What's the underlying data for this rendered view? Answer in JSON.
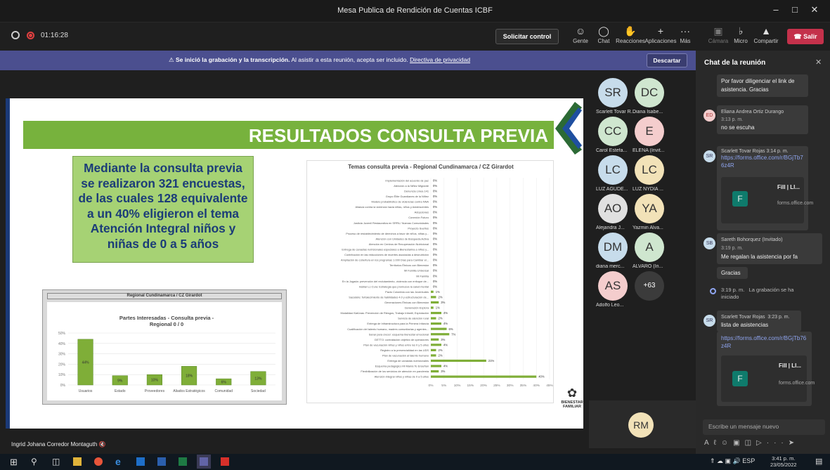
{
  "window": {
    "title": "Mesa Publica de Rendición de Cuentas ICBF"
  },
  "toolbar": {
    "timer": "01:16:28",
    "request_control": "Solicitar control",
    "buttons": [
      "Gente",
      "Chat",
      "Reacciones",
      "Aplicaciones",
      "Más",
      "Cámara",
      "Micro",
      "Compartir"
    ],
    "leave": "Salir"
  },
  "banner": {
    "bold": "Se inició la grabación y la transcripción.",
    "text": "Al asistir a esta reunión, acepta ser incluido.",
    "link": "Directiva de privacidad",
    "dismiss": "Descartar"
  },
  "slide": {
    "title": "RESULTADOS CONSULTA PREVIA",
    "summary": "Mediante la consulta previa se realizaron 321 encuestas, de las cuales 128 equivalente a un 40% eligieron el tema Atención Integral niños y niñas de 0 a 5 años",
    "logo": "BIENESTAR FAMILIAR"
  },
  "chart_data": [
    {
      "type": "bar",
      "title": "Regional Cundinamarca / CZ Girardot",
      "subtitle": "Partes Interesadas - Consulta previa - Regional 0 / 0",
      "categories": [
        "Usuarios",
        "Estado",
        "Proveedores",
        "Aliados Estratégicos",
        "Comunidad",
        "Sociedad"
      ],
      "values": [
        44,
        9,
        10,
        18,
        6,
        13
      ],
      "ylim": [
        0,
        50
      ],
      "yticks": [
        "0%",
        "10%",
        "20%",
        "30%",
        "40%",
        "50%"
      ],
      "color": "#7fae38"
    },
    {
      "type": "bar",
      "orientation": "horizontal",
      "title": "Temas consulta previa - Regional Cundinamarca / CZ Girardot",
      "categories": [
        "Implementación del acuerdo de paz",
        "Atención a la Niñez Migrante",
        "Denuncia Línea 141",
        "Grupo Élite Guardianes de la Niñez",
        "Modelo probabilístico de violencias contra NNA",
        "Alianza contra la violencia hacia niñas, niños y Adolescentes",
        "Adopciones",
        "Conexión Futuro",
        "Justicia Juvenil Restaurativa en SRPA / Nuevas Comunidades",
        "Proyecto Sueños",
        "Proceso de restablecimiento de derechos a favor de niños, niñas y...",
        "Atención con Unidades de Búsqueda Activa",
        "Atención en Centros de Recuperación Nutricional",
        "Entrega de canastas nutricionales especiales a Bienestarina a niños y...",
        "Contribución en las reducciones de muertes asociadas a desnutrición",
        "Ampliación de cobertura en los programas 1.000 Días para Cambiar el...",
        "Territorios Étnicos con Bienestar",
        "Mi Familia Universal",
        "Mi Familia",
        "En la Jugada: prevención del reclutamiento, violencia con enfoque de...",
        "Hablar Lo Cura: Estrategia que promueve la salud mental",
        "Pacto Colombia con las Juventudes",
        "Sacúdete: fortalecimiento de habilidades 4.0 y estructuración de...",
        "Generaciones Étnicas con Bienestar",
        "Generación Explora",
        "Modalidad Katünas: Prevención de Riesgos, Trabajo Infantil, Explotación",
        "Servicio de atención rural",
        "Entrega de Infraestructura para la Primera Infancia",
        "Cualificación del talento humano, madres comunitarias y agentes...",
        "Sanar para crecer: esquema bienestar emocional",
        "GETTO: contratación objetivo de operadores",
        "Plan de vacunación niñas y niños entre los 0 y 5 años",
        "Registro a la presencialidad en las UDS",
        "Plan de vacunación al talento humano",
        "Entrega de canastas nutricionales",
        "Esquema pedagógico Mi Mamá Te Enseñan",
        "Flexibilización de los servicios de atención en pandemia",
        "Atención integral niños y niñas de 0 a 5 años"
      ],
      "values": [
        0,
        0,
        0,
        0,
        0,
        0,
        0,
        0,
        0,
        0,
        0,
        0,
        0,
        0,
        0,
        0,
        0,
        0,
        0,
        0,
        0,
        1,
        2,
        3,
        1,
        4,
        2,
        4,
        6,
        7,
        3,
        4,
        2,
        2,
        21,
        4,
        3,
        40
      ],
      "xticks": [
        "0%",
        "5%",
        "10%",
        "15%",
        "20%",
        "25%",
        "30%",
        "35%",
        "40%",
        "45%"
      ],
      "xlim": [
        0,
        45
      ]
    }
  ],
  "participants": [
    {
      "initials": "SR",
      "name": "Scarlett Tovar R...",
      "color": "#c7dceb"
    },
    {
      "initials": "DC",
      "name": "Diana Isabe...",
      "color": "#cfe6cf"
    },
    {
      "initials": "CC",
      "name": "Carol Estefa...",
      "color": "#cfe6cf"
    },
    {
      "initials": "E",
      "name": "ELENA (Invit...",
      "color": "#f4cdcd"
    },
    {
      "initials": "LC",
      "name": "LUZ AGUDE...",
      "color": "#c7dceb"
    },
    {
      "initials": "LC",
      "name": "LUZ NYDIA ...",
      "color": "#f2e2b8"
    },
    {
      "initials": "AO",
      "name": "Alejandra J...",
      "color": "#e0e0e0"
    },
    {
      "initials": "YA",
      "name": "Yazmin Alva...",
      "color": "#f2e2b8"
    },
    {
      "initials": "DM",
      "name": "diana merc...",
      "color": "#c7dceb"
    },
    {
      "initials": "A",
      "name": "ALVARO (In...",
      "color": "#cfe6cf"
    },
    {
      "initials": "AS",
      "name": "Adolfo Leo...",
      "color": "#f4cdcd"
    },
    {
      "initials": "+63",
      "name": "",
      "color": "#3b3b3b"
    }
  ],
  "self_tile": {
    "initials": "RM"
  },
  "presenter": "Ingrid Johana Corredor Montaguth",
  "chat": {
    "title": "Chat de la reunión",
    "m0": "Por favor diligenciar el link de asistencia. Gracias",
    "m1_author": "Eliana Andrea Ortiz Durango",
    "m1_time": "3:13 p. m.",
    "m1_text": "no se escuha",
    "m2_author": "Scarlett Tovar Rojas",
    "m2_time": "3:14 p. m.",
    "m2_link": "https://forms.office.com/r/BGjTb76z4R",
    "card_title": "Fill | Ll...",
    "card_domain": "forms.office.com",
    "m3_author": "Sareth Bohorquez (Invitado)",
    "m3_time": "3:19 p. m.",
    "m3_text": "Me regalan la asistencia por fa",
    "m3_text2": "Gracias",
    "sys_time": "3:19 p. m.",
    "sys_text": "La grabación se ha iniciado",
    "m4_author": "Scarlett Tovar Rojas",
    "m4_time": "3:23 p. m.",
    "m4_text": "lista de asistencias",
    "m4_link": "https://forms.office.com/r/BGjTb76z4R",
    "input_placeholder": "Escribe un mensaje nuevo"
  },
  "taskbar": {
    "time": "3:41 p. m.",
    "date": "23/05/2022",
    "lang": "ESP"
  }
}
